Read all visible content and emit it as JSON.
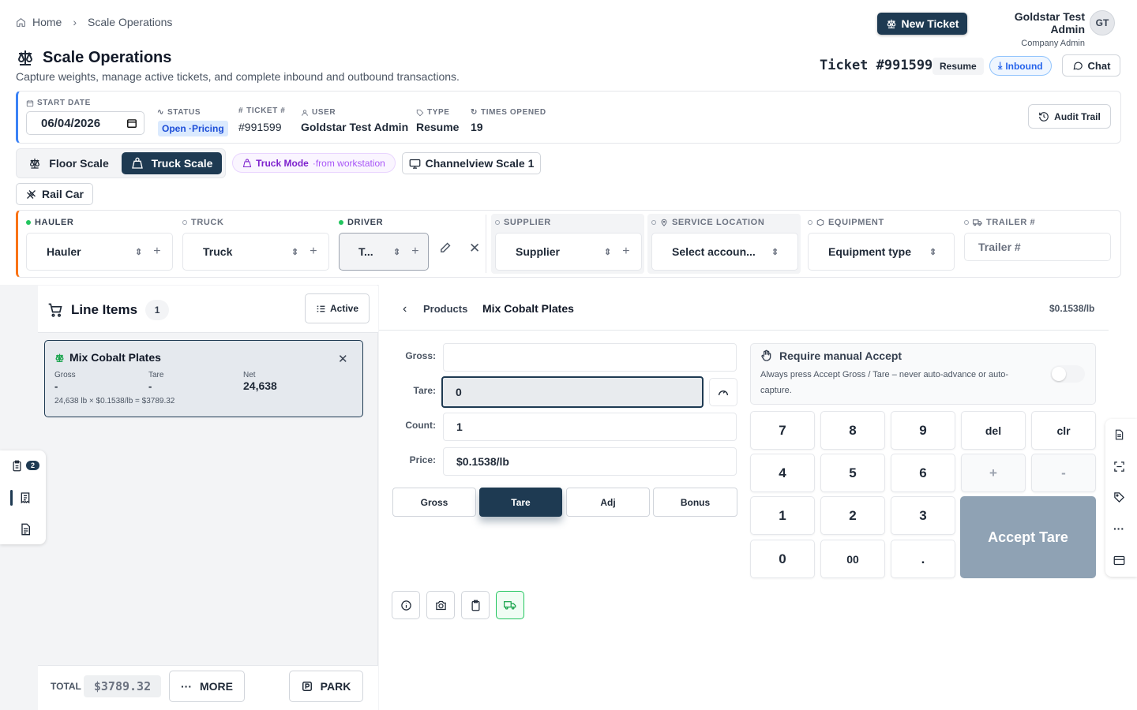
{
  "breadcrumb": {
    "home": "Home",
    "current": "Scale Operations"
  },
  "header": {
    "new_ticket": "New Ticket",
    "user_name": "Goldstar Test Admin",
    "user_role": "Company Admin",
    "avatar_initials": "GT",
    "title": "Scale Operations",
    "subtitle": "Capture weights, manage active tickets, and complete inbound and outbound transactions.",
    "ticket_number": "Ticket #991599",
    "resume_badge": "Resume",
    "inbound_badge": "Inbound",
    "chat": "Chat"
  },
  "info": {
    "start_date_label": "START DATE",
    "start_date": "06/04/2026",
    "status_label": "STATUS",
    "status_value": "Open ·Pricing",
    "ticket_label": "TICKET #",
    "ticket_value": "#991599",
    "user_label": "USER",
    "user_value": "Goldstar Test Admin",
    "type_label": "TYPE",
    "type_value": "Resume",
    "times_label": "TIMES OPENED",
    "times_value": "19",
    "audit": "Audit Trail"
  },
  "scale": {
    "floor": "Floor Scale",
    "truck": "Truck Scale",
    "truck_mode": "Truck Mode",
    "truck_mode_from": "·from workstation",
    "channel": "Channelview Scale 1",
    "railcar": "Rail Car"
  },
  "fields": {
    "hauler_label": "HAULER",
    "hauler_value": "Hauler",
    "truck_label": "TRUCK",
    "truck_value": "Truck",
    "driver_label": "DRIVER",
    "driver_value": "T...",
    "supplier_label": "SUPPLIER",
    "supplier_value": "Supplier",
    "service_label": "SERVICE LOCATION",
    "service_value": "Select accoun...",
    "equipment_label": "EQUIPMENT",
    "equipment_value": "Equipment type",
    "trailer_label": "TRAILER #",
    "trailer_placeholder": "Trailer #"
  },
  "line_items": {
    "title": "Line Items",
    "count": "1",
    "filter": "Active",
    "items": [
      {
        "name": "Mix Cobalt Plates",
        "gross_label": "Gross",
        "gross": "-",
        "tare_label": "Tare",
        "tare": "-",
        "net_label": "Net",
        "net": "24,638",
        "formula": "24,638 lb × $0.1538/lb = $3789.32"
      }
    ],
    "total_label": "TOTAL",
    "total": "$3789.32",
    "more": "MORE",
    "park": "PARK",
    "badge_count": "2"
  },
  "product": {
    "back": "Products",
    "name": "Mix Cobalt Plates",
    "price_per": "$0.1538/lb",
    "gross_label": "Gross:",
    "gross_value": "",
    "tare_label": "Tare:",
    "tare_value": "0",
    "count_label": "Count:",
    "count_value": "1",
    "price_label": "Price:",
    "price_value": "$0.1538/lb",
    "modes": [
      "Gross",
      "Tare",
      "Adj",
      "Bonus"
    ],
    "require_title": "Require manual Accept",
    "require_desc": "Always press Accept Gross / Tare – never auto-advance or auto-capture.",
    "require_on": false,
    "keys": {
      "k7": "7",
      "k8": "8",
      "k9": "9",
      "del": "del",
      "clr": "clr",
      "k4": "4",
      "k5": "5",
      "k6": "6",
      "plus": "+",
      "minus": "-",
      "k1": "1",
      "k2": "2",
      "k3": "3",
      "k0": "0",
      "k00": "00",
      "dot": "."
    },
    "accept": "Accept Tare"
  },
  "colors": {
    "primary": "#1e3a52",
    "accent_blue": "#3b82f6",
    "accent_orange": "#f97316",
    "green": "#22c55e"
  }
}
